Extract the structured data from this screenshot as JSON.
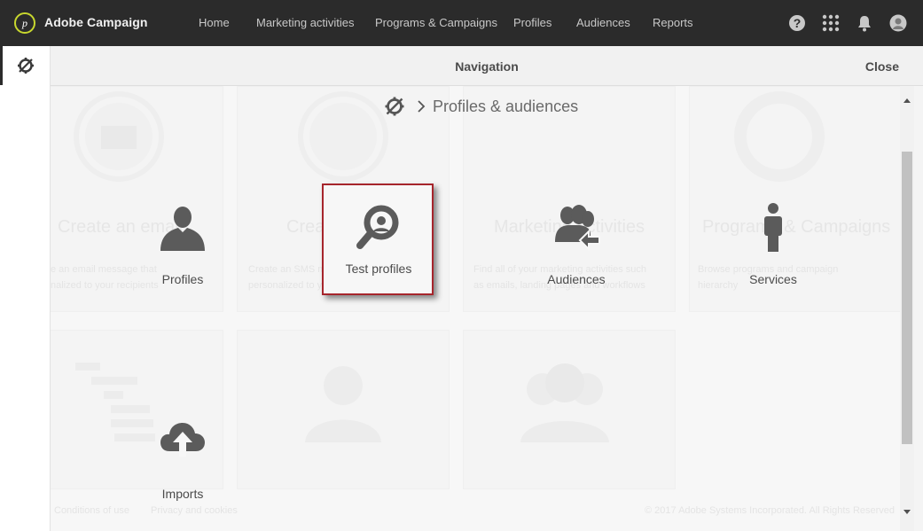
{
  "app": {
    "brand": "Adobe Campaign",
    "logo_letter": "p"
  },
  "top_nav": {
    "items": [
      {
        "label": "Home"
      },
      {
        "label": "Marketing activities"
      },
      {
        "label": "Programs & Campaigns"
      },
      {
        "label": "Profiles"
      },
      {
        "label": "Audiences"
      },
      {
        "label": "Reports"
      }
    ],
    "icons": [
      "help-icon",
      "apps-grid-icon",
      "notification-bell-icon",
      "user-avatar-icon"
    ]
  },
  "panel": {
    "title": "Navigation",
    "close_label": "Close",
    "breadcrumb": {
      "home_icon": "explorer-icon",
      "separator_icon": "chevron-right-icon",
      "current": "Profiles & audiences"
    }
  },
  "tiles": [
    {
      "label": "Profiles",
      "icon": "person-icon",
      "selected": false
    },
    {
      "label": "Test profiles",
      "icon": "search-magnifier-icon",
      "selected": true
    },
    {
      "label": "Audiences",
      "icon": "audiences-icon",
      "selected": false
    },
    {
      "label": "Services",
      "icon": "service-person-icon",
      "selected": false
    },
    {
      "label": "Imports",
      "icon": "cloud-upload-icon",
      "selected": false
    }
  ],
  "background_cards": {
    "titles": [
      "Create an email",
      "Create an SMS",
      "Marketing activities",
      "Programs & Campaigns"
    ],
    "texts": [
      "e an email message that",
      "nalized to your recipients",
      "Create an SMS message",
      "personalized to your recipients",
      "Find all of your marketing activities such",
      "as emails, landing pages and workflows",
      "Browse programs and campaign",
      "hierarchy"
    ],
    "footer_left": "Conditions of use",
    "footer_middle": "Privacy and cookies",
    "footer_right": "© 2017 Adobe Systems Incorporated. All Rights Reserved"
  },
  "colors": {
    "topbar": "#2b2b2b",
    "accent_logo": "#c8d72e",
    "selected_border": "#a6252c",
    "icon_gray": "#5b5b5b"
  }
}
